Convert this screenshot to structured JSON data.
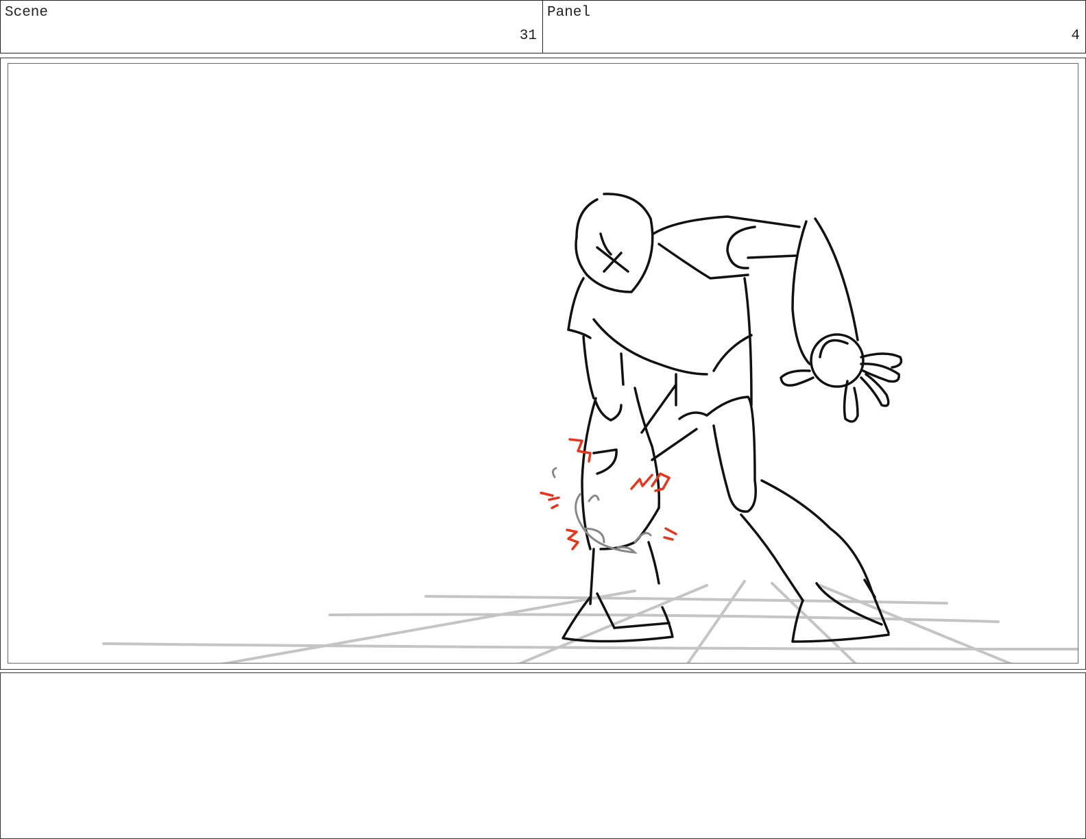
{
  "header": {
    "scene_label": "Scene",
    "scene_value": "31",
    "panel_label": "Panel",
    "panel_value": "4"
  },
  "drawing": {
    "subject": "character-bending-over-holding-knee",
    "colors": {
      "ink": "#111111",
      "impact_marks": "#e8341c",
      "motion_lines": "#888888",
      "ground_grid": "#c4c4c4"
    }
  },
  "notes": {
    "text": ""
  }
}
